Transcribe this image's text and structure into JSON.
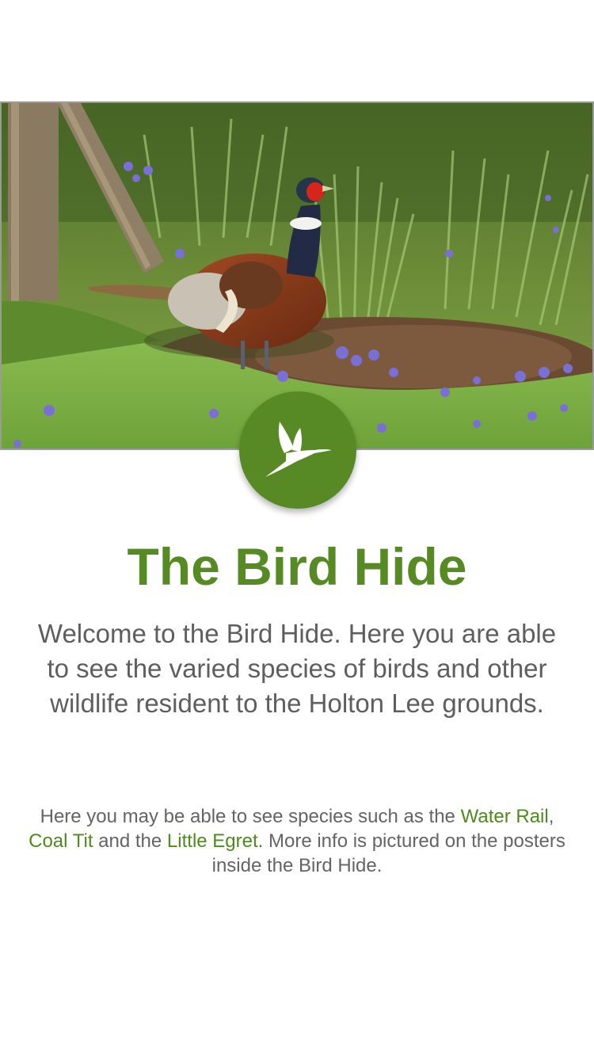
{
  "hero": {
    "image": "pheasant-in-grass-with-bluebells"
  },
  "badge": {
    "icon": "hummingbird-icon",
    "color": "#578a25"
  },
  "title": "The Bird Hide",
  "intro": "Welcome to the Bird Hide. Here you are able to see the varied species of birds and other wildlife resident to the Holton Lee grounds.",
  "detail": {
    "prefix": "Here you may be able to see species such as the ",
    "species_1": "Water Rail",
    "sep_1": ", ",
    "species_2": "Coal Tit",
    "sep_2": " and the ",
    "species_3": "Little Egret",
    "suffix": ". More info is pictured on the posters inside the Bird Hide."
  },
  "colors": {
    "accent": "#568a22",
    "body_text": "#5e5e5e",
    "link": "#4f8a1c"
  }
}
